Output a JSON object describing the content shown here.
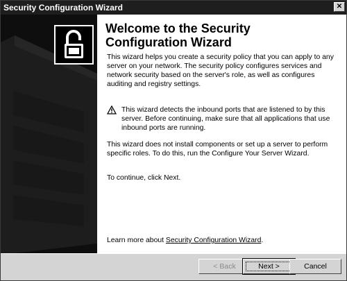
{
  "window": {
    "title": "Security Configuration Wizard",
    "close_glyph": "✕"
  },
  "content": {
    "heading": "Welcome to the Security Configuration Wizard",
    "intro": "This wizard helps you create a security policy that you can apply to any server on your network. The security policy configures services and network security based on the server's role, as well as configures auditing and registry settings.",
    "warning": "This wizard detects the inbound ports that are listened to by this server. Before continuing, make sure that all applications that use inbound ports are running.",
    "install_note": "This wizard does not install components or set up a server to perform specific roles. To do this, run the Configure Your Server Wizard.",
    "continue_text": "To continue, click Next.",
    "learn_more_prefix": "Learn more about ",
    "learn_more_link": "Security Configuration Wizard",
    "learn_more_suffix": "."
  },
  "icons": {
    "lock": "lock-icon",
    "warning": "warning-icon"
  },
  "buttons": {
    "back": "< Back",
    "next": "Next >",
    "cancel": "Cancel"
  },
  "colors": {
    "titlebar": "#1e1e1e",
    "sidebar": "#0e0e0e",
    "dialog": "#d4d4d4"
  }
}
